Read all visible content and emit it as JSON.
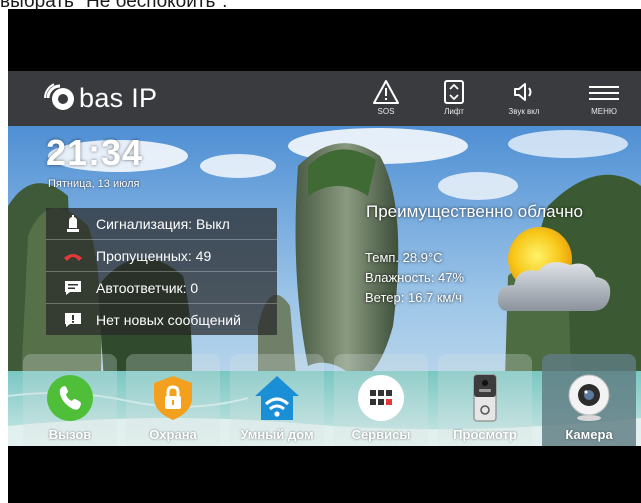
{
  "caption": "выбрать \"Не беспокоить\".",
  "brand": {
    "name": "bas IP"
  },
  "topbar": {
    "sos": {
      "label": "SOS",
      "icon": "warning-triangle-icon"
    },
    "lift": {
      "label": "Лифт",
      "icon": "elevator-icon"
    },
    "sound": {
      "label": "Звук вкл",
      "icon": "speaker-icon"
    },
    "menu": {
      "label": "МЕНЮ",
      "icon": "hamburger-menu-icon"
    }
  },
  "clock": {
    "time": "21:34",
    "date": "Пятница, 13 июля"
  },
  "status": {
    "alarm": "Сигнализация: Выкл",
    "missed": "Пропущенных: 49",
    "answering": "Автоответчик: 0",
    "messages": "Нет новых сообщений"
  },
  "weather": {
    "condition": "Преимущественно облачно",
    "temperature": "Темп. 28.9°C",
    "humidity": "Влажность: 47%",
    "wind": "Ветер: 16.7 км/ч",
    "icon": "partly-cloudy-icon"
  },
  "dock": [
    {
      "label": "Вызов",
      "icon": "phone-icon"
    },
    {
      "label": "Охрана",
      "icon": "lock-shield-icon"
    },
    {
      "label": "Умный дом",
      "icon": "smart-home-wifi-icon"
    },
    {
      "label": "Сервисы",
      "icon": "services-grid-icon"
    },
    {
      "label": "Просмотр",
      "icon": "intercom-panel-icon"
    },
    {
      "label": "Камера",
      "icon": "camera-icon"
    }
  ],
  "colors": {
    "topbar": "#3a3b3e",
    "call_green": "#4fbf3a",
    "security_orange": "#f3a01e",
    "home_blue": "#1b8fd6",
    "missed_red": "#e53935"
  }
}
